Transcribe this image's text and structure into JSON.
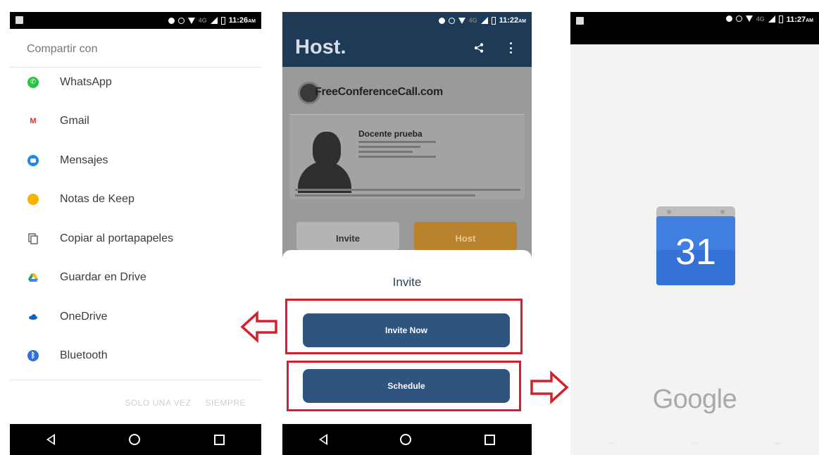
{
  "phone_share": {
    "status_time": "11:26",
    "status_ampm": "AM",
    "status_net": "4G",
    "title": "Compartir con",
    "items": [
      {
        "label": "WhatsApp",
        "icon": "whatsapp-icon",
        "color": "#25c244"
      },
      {
        "label": "Gmail",
        "icon": "gmail-icon",
        "color": "#d93025"
      },
      {
        "label": "Mensajes",
        "icon": "messages-icon",
        "color": "#1e88e5"
      },
      {
        "label": "Notas de Keep",
        "icon": "keep-icon",
        "color": "#f6b400"
      },
      {
        "label": "Copiar al portapapeles",
        "icon": "copy-icon",
        "color": "#666666"
      },
      {
        "label": "Guardar en Drive",
        "icon": "drive-icon",
        "color": "#1fa463"
      },
      {
        "label": "OneDrive",
        "icon": "onedrive-icon",
        "color": "#0a64c8"
      },
      {
        "label": "Bluetooth",
        "icon": "bluetooth-icon",
        "color": "#2f6fd6"
      }
    ],
    "action_once": "SOLO UNA VEZ",
    "action_always": "SIEMPRE"
  },
  "phone_host": {
    "status_time": "11:22",
    "status_ampm": "AM",
    "status_net": "4G",
    "app_title": "Host.",
    "logo_text": "FreeConferenceCall.com",
    "profile_name": "Docente prueba",
    "bg_invite_label": "Invite",
    "bg_host_label": "Host",
    "sheet_title": "Invite",
    "invite_now_label": "Invite Now",
    "schedule_label": "Schedule",
    "colors": {
      "appbar": "#1f3a57",
      "button": "#2f5480",
      "highlight": "#d4202a",
      "host": "#b8822e"
    }
  },
  "phone_calendar": {
    "status_time": "11:27",
    "status_ampm": "AM",
    "status_net": "4G",
    "calendar_day": "31",
    "brand_text": "Google"
  }
}
